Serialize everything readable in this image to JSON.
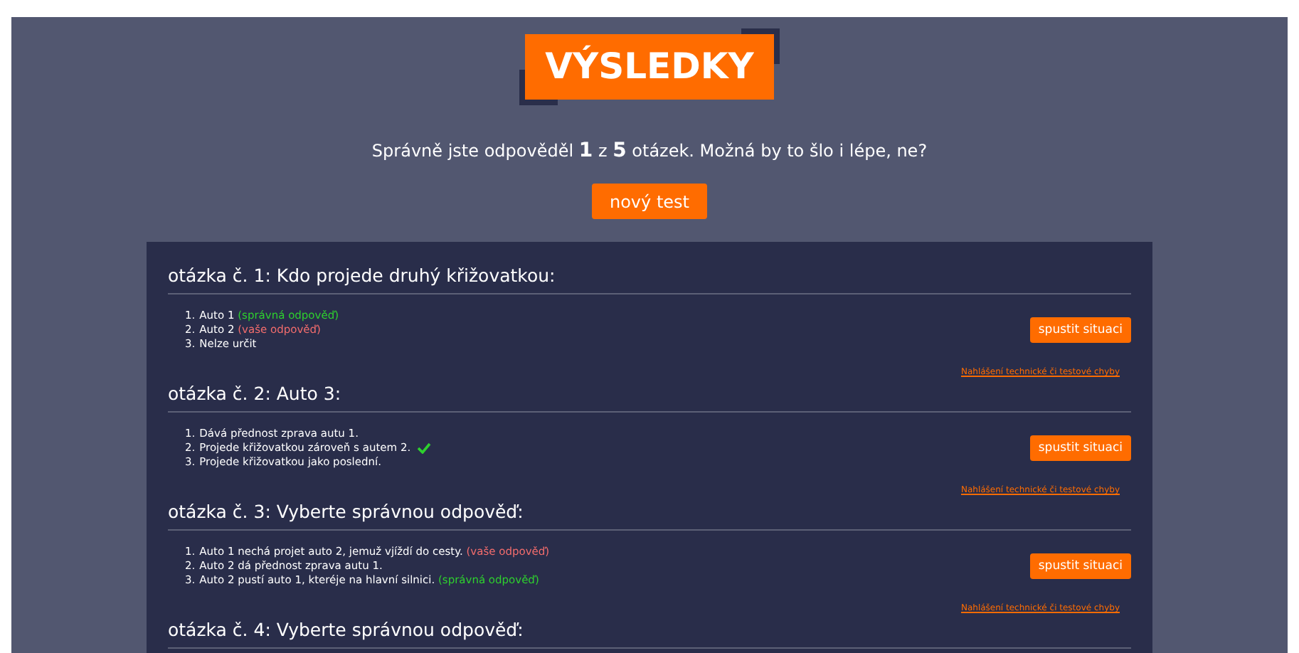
{
  "title": "VÝSLEDKY",
  "summary": "Správně jste odpověděl **1** z **5** otázek. Možná by to šlo i lépe, ne?",
  "new_test_button": "nový test",
  "questions": [
    {
      "title": "otázka č. 1: Kdo projede druhý křižovatkou:",
      "button": "spustit situaci",
      "report_link": "Nahlášení technické či testové chyby",
      "answers": [
        {
          "number": "1.",
          "text": "Auto 1",
          "kind": "correct",
          "note": "(správná odpověď)"
        },
        {
          "number": "2.",
          "text": "Auto 2",
          "kind": "wrong",
          "note": "(vaše odpověď)"
        },
        {
          "number": "3.",
          "text": "Nelze určit",
          "kind": "plain"
        }
      ]
    },
    {
      "title": "otázka č. 2: Auto 3:",
      "button": "spustit situaci",
      "report_link": "Nahlášení technické či testové chyby",
      "answers": [
        {
          "number": "1.",
          "text": "Dává přednost zprava autu 1.",
          "kind": "plain"
        },
        {
          "number": "2.",
          "text": "Projede křižovatkou zároveň s autem 2.",
          "kind": "chosen-correct"
        },
        {
          "number": "3.",
          "text": "Projede křižovatkou jako poslední.",
          "kind": "plain"
        }
      ]
    },
    {
      "title": "otázka č. 3: Vyberte správnou odpověď:",
      "button": "spustit situaci",
      "report_link": "Nahlášení technické či testové chyby",
      "answers": [
        {
          "number": "1.",
          "text": "Auto 1 nechá projet auto 2, jemuž vjíždí do cesty.",
          "kind": "wrong",
          "note": "(vaše odpověď)"
        },
        {
          "number": "2.",
          "text": "Auto 2 dá přednost zprava autu 1.",
          "kind": "plain"
        },
        {
          "number": "3.",
          "text": "Auto 2 pustí auto 1, kteréje na hlavní silnici.",
          "kind": "correct",
          "note": "(správná odpověď)"
        }
      ]
    },
    {
      "title": "otázka č. 4: Vyberte správnou odpověď:"
    }
  ]
}
